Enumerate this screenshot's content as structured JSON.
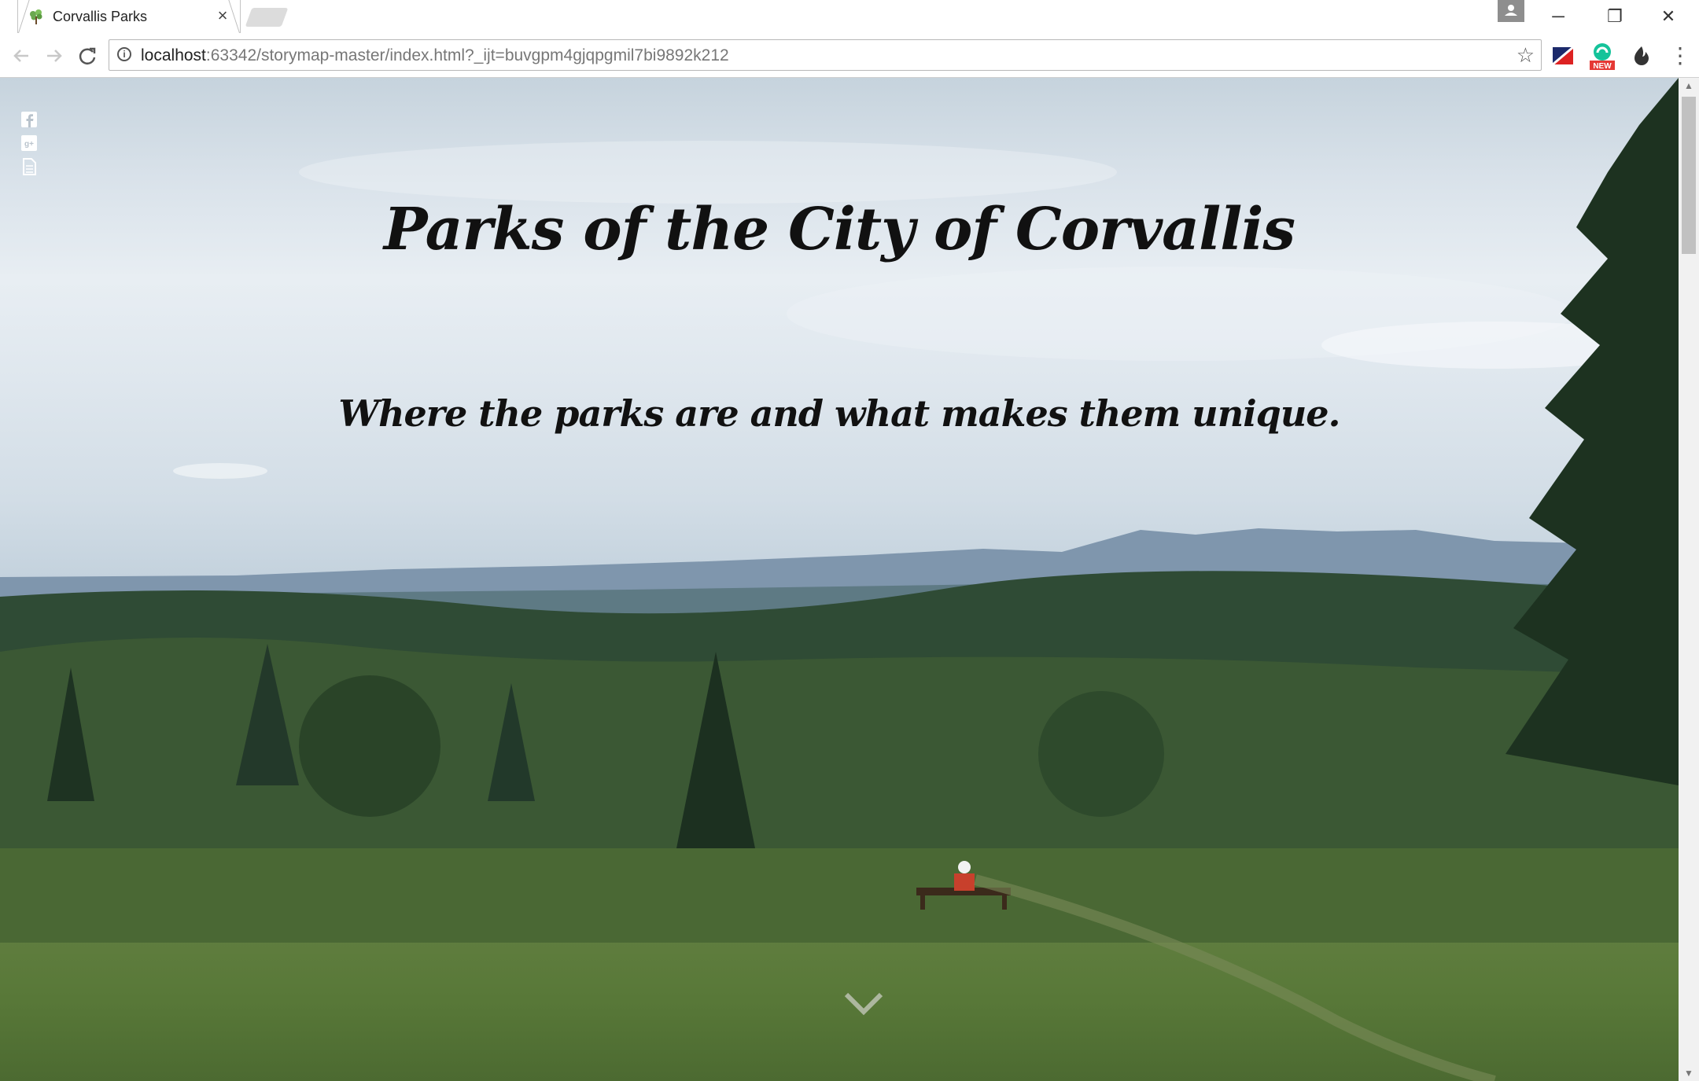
{
  "browser": {
    "tab_title": "Corvallis Parks",
    "tab_close": "×",
    "url_host": "localhost",
    "url_rest": ":63342/storymap-master/index.html?_ijt=buvgpm4gjqpgmil7bi9892k212",
    "window_controls": {
      "minimize": "─",
      "restore": "❐",
      "close": "✕"
    },
    "extensions": [
      "flag-extension-icon",
      "grammarly-new-icon",
      "dark-flame-icon"
    ],
    "ext_badge": "NEW"
  },
  "page": {
    "title": "Parks of the City of Corvallis",
    "subtitle": "Where the parks are and what makes them unique.",
    "social_icons": [
      "facebook-icon",
      "google-plus-icon",
      "document-icon"
    ],
    "scroll_hint_icon": "chevron-down-icon"
  }
}
